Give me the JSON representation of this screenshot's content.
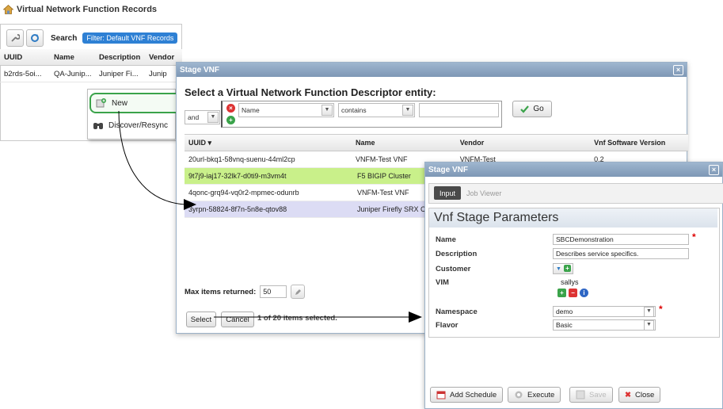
{
  "page": {
    "title": "Virtual Network Function Records"
  },
  "records": {
    "search_label": "Search",
    "filter_label": "Filter: Default VNF Records",
    "columns": [
      "UUID",
      "Name",
      "Description",
      "Vendor"
    ],
    "rows": [
      {
        "uuid": "b2rds-5oi...",
        "name": "QA-Junip...",
        "description": "Juniper Fi...",
        "vendor": "Junip"
      }
    ]
  },
  "context_menu": {
    "items": [
      {
        "label": "New",
        "icon": "new-record-icon"
      },
      {
        "label": "Discover/Resync",
        "icon": "binoculars-icon"
      }
    ]
  },
  "stage_dialog": {
    "title": "Stage VNF",
    "heading": "Select a Virtual Network Function Descriptor entity:",
    "filter": {
      "conjunction": "and",
      "field": "Name",
      "operator": "contains",
      "value": ""
    },
    "go_label": "Go",
    "columns": [
      "UUID",
      "Name",
      "Vendor",
      "Vnf Software Version"
    ],
    "rows": [
      {
        "uuid": "20url-bkq1-58vnq-suenu-44ml2cp",
        "name": "VNFM-Test VNF",
        "vendor": "VNFM-Test",
        "version": "0.2",
        "style": "normal"
      },
      {
        "uuid": "9t7j9-iaj17-32lk7-d0ti9-m3vm4t",
        "name": "F5 BIGIP Cluster",
        "vendor": "",
        "version": "",
        "style": "green"
      },
      {
        "uuid": "4qonc-grq94-vq0r2-mpmec-odunrb",
        "name": "VNFM-Test VNF",
        "vendor": "",
        "version": "",
        "style": "normal"
      },
      {
        "uuid": "3yrpn-58824-8f7n-5n8e-qtov88",
        "name": "Juniper Firefly SRX Cluste",
        "vendor": "",
        "version": "",
        "style": "lavender"
      }
    ],
    "max_items_label": "Max items returned:",
    "max_items_value": "50",
    "select_label": "Select",
    "cancel_label": "Cancel",
    "selection_status": "1 of 20 items selected."
  },
  "params_dialog": {
    "title": "Stage VNF",
    "tabs": [
      {
        "label": "Input",
        "active": true
      },
      {
        "label": "Job Viewer",
        "active": false
      }
    ],
    "section_title": "Vnf Stage Parameters",
    "fields": {
      "name_label": "Name",
      "name_value": "SBCDemonstration",
      "description_label": "Description",
      "description_value": "Describes service specifics.",
      "customer_label": "Customer",
      "vim_label": "VIM",
      "vim_value": "sallys",
      "namespace_label": "Namespace",
      "namespace_value": "demo",
      "flavor_label": "Flavor",
      "flavor_value": "Basic"
    },
    "buttons": {
      "add_schedule": "Add Schedule",
      "execute": "Execute",
      "save": "Save",
      "close": "Close"
    }
  },
  "colors": {
    "titlebar": "#8aa3bf",
    "selected_row": "#c9f08a",
    "highlight_row": "#dcdcf4",
    "new_highlight": "#3aa34a",
    "filter_pill": "#2e80d4",
    "required": "#dd0000"
  }
}
